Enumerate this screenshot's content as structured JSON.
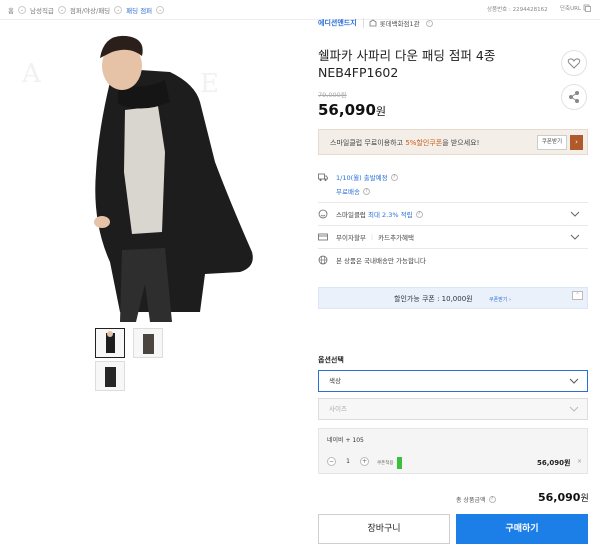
{
  "breadcrumb": {
    "home": "홈",
    "items": [
      "남성직급",
      "점퍼/야상/패딩",
      "패딩 점퍼"
    ]
  },
  "product_no": "상품번호 : 2294428162",
  "share_url": "단축URL",
  "brand": "에디션앤드지",
  "store": "롯데백화점1관",
  "title": "쉘파카 사파리 다운 패딩 점퍼 4종 NEB4FP1602",
  "original_price": "79,000원",
  "price": "56,090",
  "price_unit": "원",
  "coupon_banner": {
    "text_prefix": "스마일클럽 무료이용하고",
    "text_highlight": "5%할인쿠폰",
    "text_suffix": "을 받으세요!",
    "button": "쿠폰받기",
    "arrow": "›"
  },
  "shipping": {
    "date": "1/10(월) 출발예정",
    "fee": "무료배송"
  },
  "smile": {
    "prefix": "스마일클럽",
    "highlight": "최대 2.3% 적립"
  },
  "installment": {
    "label": "무이자할부",
    "value": "카드추가혜택"
  },
  "domestic": "본 상품은 국내배송만 가능합니다",
  "available_coupon": {
    "text": "할인가능 쿠폰 : 10,000원",
    "link": "쿠폰받기 ›"
  },
  "options": {
    "label": "옵션선택",
    "color_placeholder": "색상",
    "size_placeholder": "사이즈"
  },
  "selected": {
    "name": "네이비 + 105",
    "qty": "1",
    "coupon_label": "쿠폰적용",
    "amount": "56,090원",
    "remove": "×"
  },
  "total": {
    "label": "총 상품금액",
    "value": "56,090",
    "unit": "원"
  },
  "buttons": {
    "cart": "장바구니",
    "buy": "구매하기"
  },
  "colors": {
    "accent": "#1c7fe8",
    "coupon_highlight": "#c85a18"
  }
}
